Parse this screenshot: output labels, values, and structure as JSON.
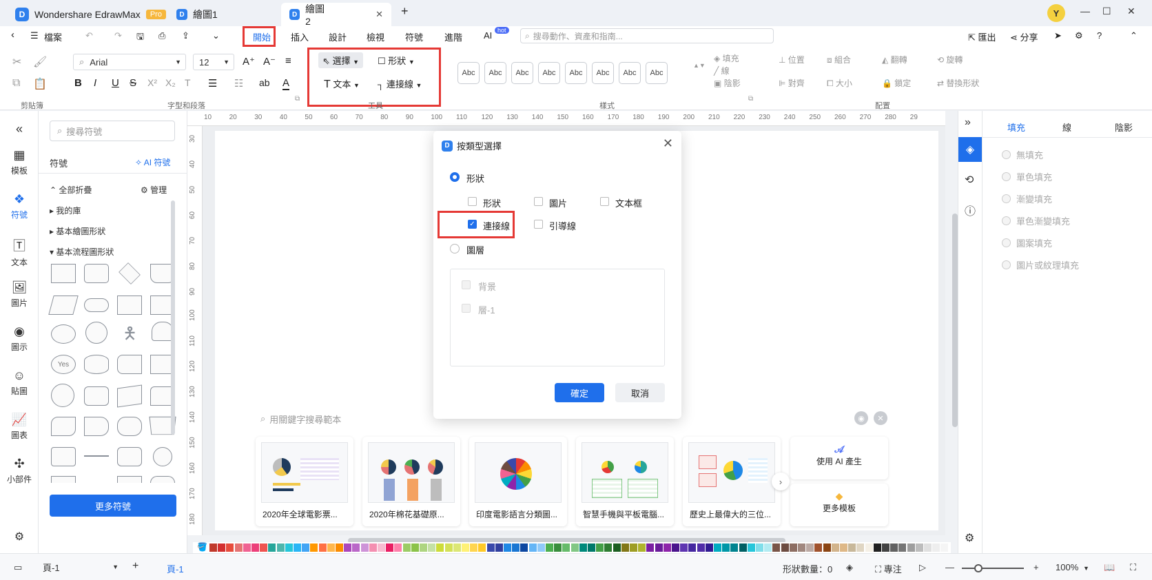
{
  "titlebar": {
    "app_name": "Wondershare EdrawMax",
    "pro_badge": "Pro",
    "tabs": [
      {
        "label": "繪圖1"
      },
      {
        "label": "繪圖2"
      }
    ],
    "new_tab": "+",
    "avatar_letter": "Y"
  },
  "menubar": {
    "file_label": "檔案",
    "items": [
      "開始",
      "插入",
      "設計",
      "檢視",
      "符號",
      "進階",
      "AI"
    ],
    "ai_badge": "hot",
    "search_placeholder": "搜尋動作、資產和指南...",
    "export_label": "匯出",
    "share_label": "分享"
  },
  "ribbon": {
    "clipboard_label": "剪貼簿",
    "font_name": "Arial",
    "font_size": "12",
    "font_group_label": "字型和段落",
    "tools": {
      "select": "選擇",
      "shape": "形狀",
      "text": "文本",
      "connector": "連接線",
      "group_label": "工具"
    },
    "styles": {
      "swatch_label": "Abc",
      "fill": "填充",
      "line": "線",
      "shadow": "陰影",
      "group_label": "樣式"
    },
    "arrange": {
      "position": "位置",
      "group": "組合",
      "flip": "翻轉",
      "rotate": "旋轉",
      "align": "對齊",
      "size": "大小",
      "lock": "鎖定",
      "replace": "替換形狀",
      "group_label": "配置"
    }
  },
  "leftrail": {
    "items": [
      "模板",
      "符號",
      "文本",
      "圖片",
      "圖示",
      "貼圖",
      "圖表",
      "小部件"
    ]
  },
  "symbols": {
    "search_placeholder": "搜尋符號",
    "heading": "符號",
    "ai_symbols": "AI 符號",
    "collapse_all": "全部折疊",
    "manage": "管理",
    "categories": [
      "我的庫",
      "基本繪圖形狀",
      "基本流程圖形狀"
    ],
    "yes_shape": "Yes",
    "more_button": "更多符號"
  },
  "ruler": {
    "h_ticks": [
      "10",
      "20",
      "30",
      "40",
      "50",
      "60",
      "70",
      "80",
      "90",
      "100",
      "110",
      "120",
      "130",
      "140",
      "150",
      "160",
      "170",
      "180",
      "190",
      "200",
      "210",
      "220",
      "230",
      "240",
      "250",
      "260",
      "270",
      "280",
      "29"
    ],
    "v_ticks": [
      "30",
      "40",
      "50",
      "60",
      "70",
      "80",
      "90",
      "100",
      "110",
      "120",
      "130",
      "140",
      "150",
      "160",
      "170",
      "180"
    ]
  },
  "templates": {
    "search_placeholder": "用關鍵字搜尋範本",
    "cards": [
      {
        "title": "2020年全球電影票..."
      },
      {
        "title": "2020年棉花基礎原..."
      },
      {
        "title": "印度電影語言分類圖..."
      },
      {
        "title": "智慧手機與平板電腦..."
      },
      {
        "title": "歷史上最偉大的三位..."
      }
    ],
    "ai_generate": "使用 AI 產生",
    "more_templates": "更多模板"
  },
  "dialog": {
    "title": "按類型選擇",
    "option_shape": "形狀",
    "cb_shape": "形狀",
    "cb_image": "圖片",
    "cb_textbox": "文本框",
    "cb_connector": "連接線",
    "cb_leader": "引導線",
    "option_layer": "圖層",
    "layer_background": "背景",
    "layer_1": "層-1",
    "ok": "確定",
    "cancel": "取消"
  },
  "rightpanel": {
    "tabs": [
      "填充",
      "線",
      "陰影"
    ],
    "fill_options": [
      "無填充",
      "單色填充",
      "漸變填充",
      "單色漸變填充",
      "圖案填充",
      "圖片或紋理填充"
    ]
  },
  "statusbar": {
    "page_select": "頁-1",
    "add_page": "+",
    "page_tab": "頁-1",
    "shape_count": "形狀數量：0",
    "focus": "專注",
    "zoom": "100%"
  },
  "colors": {
    "accent": "#1f6feb",
    "highlight_box": "#e53935",
    "palette": [
      "#c0392b",
      "#d32f2f",
      "#e74c3c",
      "#e57373",
      "#f06292",
      "#ec407a",
      "#ef5350",
      "#26a69a",
      "#4db6ac",
      "#26c6da",
      "#29b6f6",
      "#42a5f5",
      "#ff9800",
      "#ff7043",
      "#ffb74d",
      "#fb8c00",
      "#ab47bc",
      "#ba68c8",
      "#ce93d8",
      "#f48fb1",
      "#f8bbd0",
      "#e91e63",
      "#ff80ab",
      "#9ccc65",
      "#8bc34a",
      "#aed581",
      "#c5e1a5",
      "#cddc39",
      "#d4e157",
      "#dce775",
      "#fff176",
      "#ffd54f",
      "#ffca28",
      "#3949ab",
      "#303f9f",
      "#1e88e5",
      "#1976d2",
      "#0d47a1",
      "#64b5f6",
      "#90caf9",
      "#4caf50",
      "#388e3c",
      "#66bb6a",
      "#81c784",
      "#00897b",
      "#00796b",
      "#43a047",
      "#2e7d32",
      "#1b5e20",
      "#827717",
      "#9e9d24",
      "#afb42b",
      "#7b1fa2",
      "#6a1b9a",
      "#8e24aa",
      "#4a148c",
      "#5e35b1",
      "#4527a0",
      "#512da8",
      "#311b92",
      "#00acc1",
      "#0097a7",
      "#00838f",
      "#006064",
      "#26c6da",
      "#80deea",
      "#b2ebf2",
      "#795548",
      "#6d4c41",
      "#8d6e63",
      "#a1887f",
      "#bcaaa4",
      "#a0522d",
      "#8b4513",
      "#d2b48c",
      "#deb887",
      "#c8b89a",
      "#e0d6c3",
      "#f5f0e6",
      "#212121",
      "#424242",
      "#616161",
      "#757575",
      "#9e9e9e",
      "#bdbdbd",
      "#e0e0e0",
      "#eeeeee",
      "#f5f5f5"
    ]
  }
}
